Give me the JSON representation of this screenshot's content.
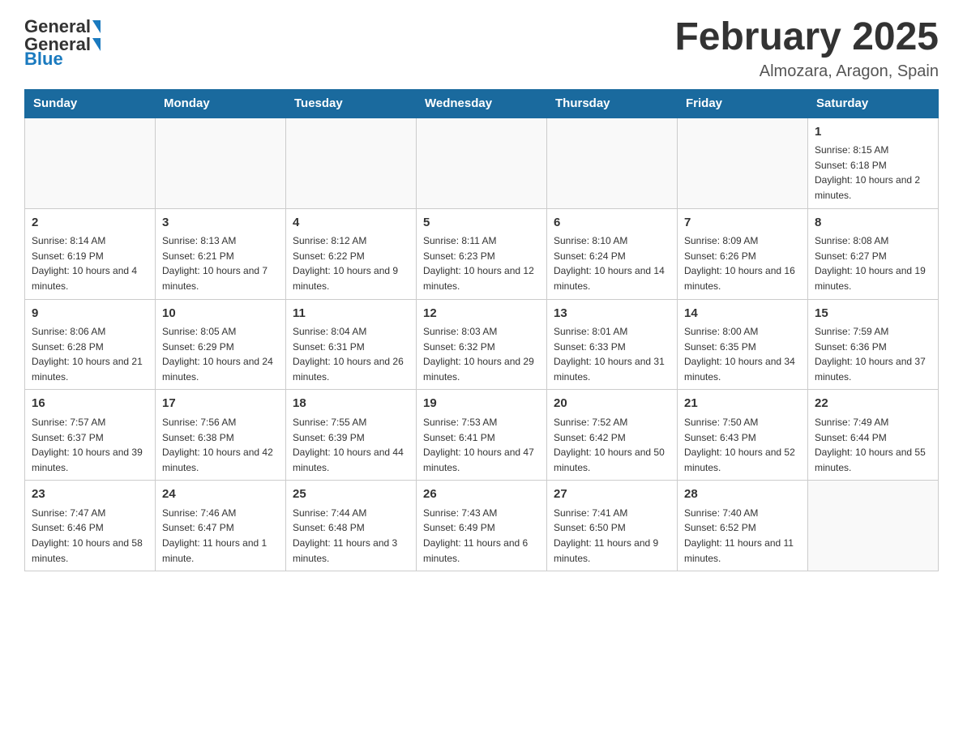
{
  "header": {
    "logo_general": "General",
    "logo_blue": "Blue",
    "month_title": "February 2025",
    "location": "Almozara, Aragon, Spain"
  },
  "days_of_week": [
    "Sunday",
    "Monday",
    "Tuesday",
    "Wednesday",
    "Thursday",
    "Friday",
    "Saturday"
  ],
  "weeks": [
    {
      "cells": [
        {
          "empty": true
        },
        {
          "empty": true
        },
        {
          "empty": true
        },
        {
          "empty": true
        },
        {
          "empty": true
        },
        {
          "empty": true
        },
        {
          "day": "1",
          "sunrise": "Sunrise: 8:15 AM",
          "sunset": "Sunset: 6:18 PM",
          "daylight": "Daylight: 10 hours and 2 minutes."
        }
      ]
    },
    {
      "cells": [
        {
          "day": "2",
          "sunrise": "Sunrise: 8:14 AM",
          "sunset": "Sunset: 6:19 PM",
          "daylight": "Daylight: 10 hours and 4 minutes."
        },
        {
          "day": "3",
          "sunrise": "Sunrise: 8:13 AM",
          "sunset": "Sunset: 6:21 PM",
          "daylight": "Daylight: 10 hours and 7 minutes."
        },
        {
          "day": "4",
          "sunrise": "Sunrise: 8:12 AM",
          "sunset": "Sunset: 6:22 PM",
          "daylight": "Daylight: 10 hours and 9 minutes."
        },
        {
          "day": "5",
          "sunrise": "Sunrise: 8:11 AM",
          "sunset": "Sunset: 6:23 PM",
          "daylight": "Daylight: 10 hours and 12 minutes."
        },
        {
          "day": "6",
          "sunrise": "Sunrise: 8:10 AM",
          "sunset": "Sunset: 6:24 PM",
          "daylight": "Daylight: 10 hours and 14 minutes."
        },
        {
          "day": "7",
          "sunrise": "Sunrise: 8:09 AM",
          "sunset": "Sunset: 6:26 PM",
          "daylight": "Daylight: 10 hours and 16 minutes."
        },
        {
          "day": "8",
          "sunrise": "Sunrise: 8:08 AM",
          "sunset": "Sunset: 6:27 PM",
          "daylight": "Daylight: 10 hours and 19 minutes."
        }
      ]
    },
    {
      "cells": [
        {
          "day": "9",
          "sunrise": "Sunrise: 8:06 AM",
          "sunset": "Sunset: 6:28 PM",
          "daylight": "Daylight: 10 hours and 21 minutes."
        },
        {
          "day": "10",
          "sunrise": "Sunrise: 8:05 AM",
          "sunset": "Sunset: 6:29 PM",
          "daylight": "Daylight: 10 hours and 24 minutes."
        },
        {
          "day": "11",
          "sunrise": "Sunrise: 8:04 AM",
          "sunset": "Sunset: 6:31 PM",
          "daylight": "Daylight: 10 hours and 26 minutes."
        },
        {
          "day": "12",
          "sunrise": "Sunrise: 8:03 AM",
          "sunset": "Sunset: 6:32 PM",
          "daylight": "Daylight: 10 hours and 29 minutes."
        },
        {
          "day": "13",
          "sunrise": "Sunrise: 8:01 AM",
          "sunset": "Sunset: 6:33 PM",
          "daylight": "Daylight: 10 hours and 31 minutes."
        },
        {
          "day": "14",
          "sunrise": "Sunrise: 8:00 AM",
          "sunset": "Sunset: 6:35 PM",
          "daylight": "Daylight: 10 hours and 34 minutes."
        },
        {
          "day": "15",
          "sunrise": "Sunrise: 7:59 AM",
          "sunset": "Sunset: 6:36 PM",
          "daylight": "Daylight: 10 hours and 37 minutes."
        }
      ]
    },
    {
      "cells": [
        {
          "day": "16",
          "sunrise": "Sunrise: 7:57 AM",
          "sunset": "Sunset: 6:37 PM",
          "daylight": "Daylight: 10 hours and 39 minutes."
        },
        {
          "day": "17",
          "sunrise": "Sunrise: 7:56 AM",
          "sunset": "Sunset: 6:38 PM",
          "daylight": "Daylight: 10 hours and 42 minutes."
        },
        {
          "day": "18",
          "sunrise": "Sunrise: 7:55 AM",
          "sunset": "Sunset: 6:39 PM",
          "daylight": "Daylight: 10 hours and 44 minutes."
        },
        {
          "day": "19",
          "sunrise": "Sunrise: 7:53 AM",
          "sunset": "Sunset: 6:41 PM",
          "daylight": "Daylight: 10 hours and 47 minutes."
        },
        {
          "day": "20",
          "sunrise": "Sunrise: 7:52 AM",
          "sunset": "Sunset: 6:42 PM",
          "daylight": "Daylight: 10 hours and 50 minutes."
        },
        {
          "day": "21",
          "sunrise": "Sunrise: 7:50 AM",
          "sunset": "Sunset: 6:43 PM",
          "daylight": "Daylight: 10 hours and 52 minutes."
        },
        {
          "day": "22",
          "sunrise": "Sunrise: 7:49 AM",
          "sunset": "Sunset: 6:44 PM",
          "daylight": "Daylight: 10 hours and 55 minutes."
        }
      ]
    },
    {
      "cells": [
        {
          "day": "23",
          "sunrise": "Sunrise: 7:47 AM",
          "sunset": "Sunset: 6:46 PM",
          "daylight": "Daylight: 10 hours and 58 minutes."
        },
        {
          "day": "24",
          "sunrise": "Sunrise: 7:46 AM",
          "sunset": "Sunset: 6:47 PM",
          "daylight": "Daylight: 11 hours and 1 minute."
        },
        {
          "day": "25",
          "sunrise": "Sunrise: 7:44 AM",
          "sunset": "Sunset: 6:48 PM",
          "daylight": "Daylight: 11 hours and 3 minutes."
        },
        {
          "day": "26",
          "sunrise": "Sunrise: 7:43 AM",
          "sunset": "Sunset: 6:49 PM",
          "daylight": "Daylight: 11 hours and 6 minutes."
        },
        {
          "day": "27",
          "sunrise": "Sunrise: 7:41 AM",
          "sunset": "Sunset: 6:50 PM",
          "daylight": "Daylight: 11 hours and 9 minutes."
        },
        {
          "day": "28",
          "sunrise": "Sunrise: 7:40 AM",
          "sunset": "Sunset: 6:52 PM",
          "daylight": "Daylight: 11 hours and 11 minutes."
        },
        {
          "empty": true
        }
      ]
    }
  ]
}
